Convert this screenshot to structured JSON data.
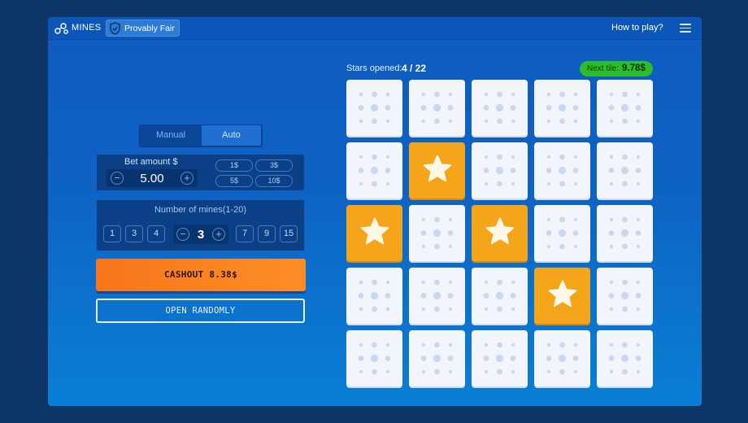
{
  "header": {
    "game_title": "MINES",
    "provably_fair_label": "Provably Fair",
    "how_to_play": "How to play?"
  },
  "mode": {
    "tabs": [
      "Manual",
      "Auto"
    ],
    "active": "Auto"
  },
  "bet": {
    "label": "Bet amount $",
    "value": "5.00",
    "quick_amounts": [
      "1$",
      "3$",
      "5$",
      "10$"
    ]
  },
  "mines": {
    "label": "Number of mines(1-20)",
    "value": "3",
    "options_left": [
      "1",
      "3",
      "4"
    ],
    "options_right": [
      "7",
      "9",
      "15"
    ]
  },
  "actions": {
    "cashout_label": "CASHOUT 8.38$",
    "random_label": "OPEN RANDOMLY"
  },
  "board": {
    "stars_label": "Stars opened:",
    "stars_count": "4 / 22",
    "next_tile_label": "Next tile:",
    "next_tile_value": "9.78$",
    "rows": 5,
    "cols": 5,
    "revealed_stars": [
      [
        1,
        1
      ],
      [
        2,
        0
      ],
      [
        2,
        2
      ],
      [
        3,
        3
      ]
    ]
  },
  "colors": {
    "background": "#0d3566",
    "panel": "#0f5bbf",
    "accent_orange": "#f7761a",
    "star_tile": "#f4a519",
    "next_tile_badge": "#2bbd2b"
  },
  "icons": [
    "mines-logo-icon",
    "shield-check-icon",
    "hamburger-menu-icon",
    "minus-icon",
    "plus-icon",
    "star-icon"
  ]
}
